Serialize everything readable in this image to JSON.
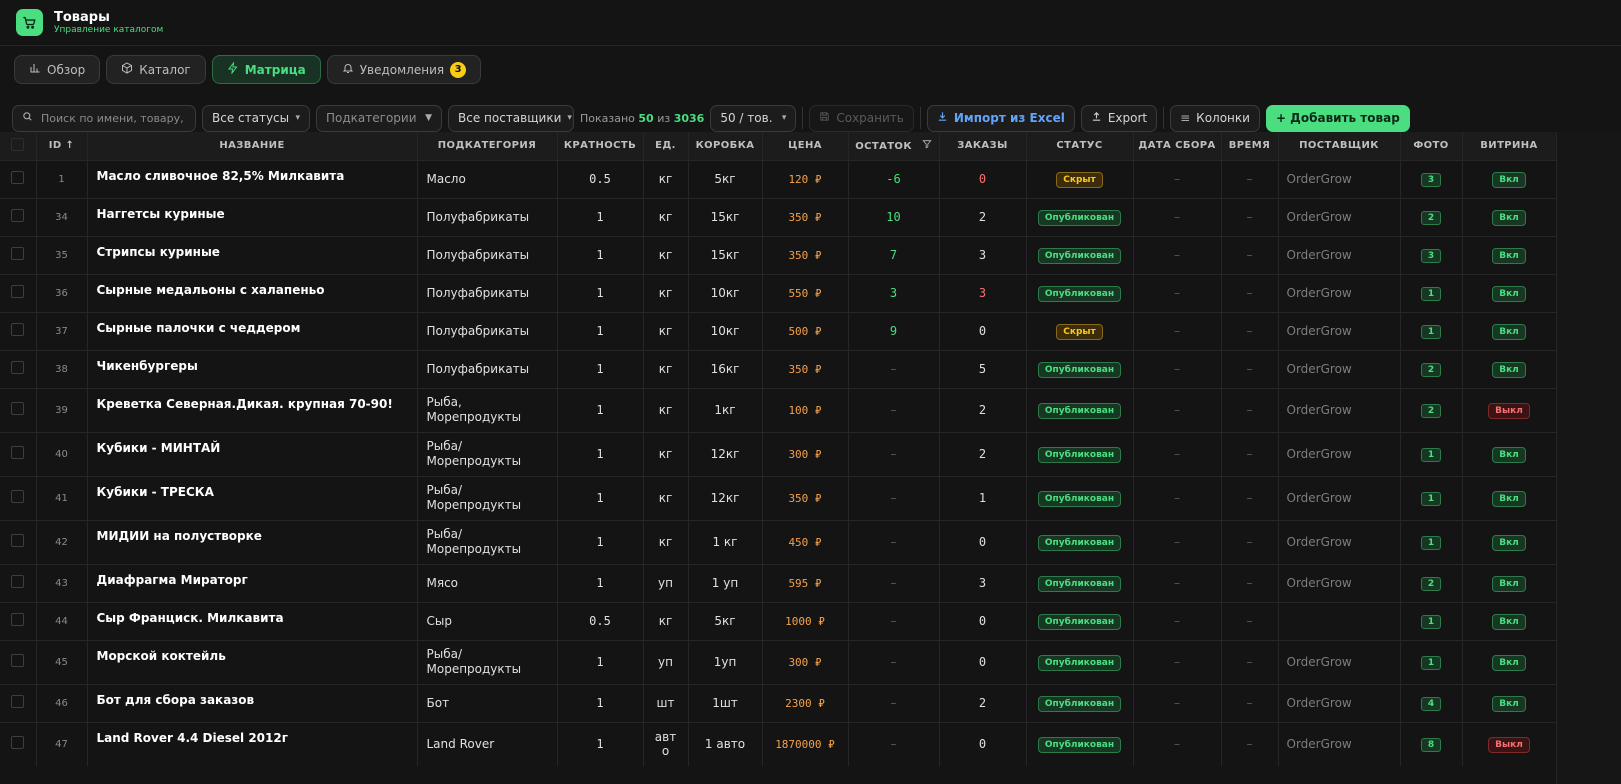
{
  "app": {
    "title": "Товары",
    "subtitle": "Управление каталогом"
  },
  "tabs": [
    {
      "label": "Обзор",
      "icon": "bar-chart-icon",
      "active": false
    },
    {
      "label": "Каталог",
      "icon": "box-icon",
      "active": false
    },
    {
      "label": "Матрица",
      "icon": "lightning-icon",
      "active": true
    },
    {
      "label": "Уведомления",
      "icon": "bell-icon",
      "active": false,
      "badge": "3"
    }
  ],
  "toolbar": {
    "search_placeholder": "Поиск по имени, товару, а",
    "status_filter": "Все статусы",
    "subcategory_filter": "Подкатегории",
    "supplier_filter": "Все поставщики",
    "shown_prefix": "Показано",
    "shown_count": "50",
    "shown_of": "из",
    "shown_total": "3036",
    "per_page": "50 / тов.",
    "save_label": "Сохранить",
    "import_label": "Импорт из Excel",
    "export_label": "Export",
    "columns_label": "Колонки",
    "add_label": "+ Добавить товар"
  },
  "columns": {
    "id": "ID ↑",
    "name": "НАЗВАНИЕ",
    "subcategory": "ПОДКАТЕГОРИЯ",
    "multiplicity": "КРАТНОСТЬ",
    "unit": "ЕД.",
    "box": "КОРОБКА",
    "price": "ЦЕНА",
    "stock": "ОСТАТОК",
    "orders": "ЗАКАЗЫ",
    "status": "СТАТУС",
    "date": "ДАТА СБОРА",
    "time": "ВРЕМЯ",
    "supplier": "ПОСТАВЩИК",
    "photo": "ФОТО",
    "showcase": "ВИТРИНА"
  },
  "rows": [
    {
      "id": "1",
      "name": "Масло сливочное 82,5% Милкавита",
      "sub": [
        "Масло"
      ],
      "mult": "0.5",
      "unit": [
        "кг"
      ],
      "box": "5кг",
      "price": "120 ₽",
      "stock": "-6",
      "stock_color": "green",
      "orders": "0",
      "orders_color": "red",
      "status": "Скрыт",
      "status_type": "hid",
      "date": "–",
      "time": "–",
      "supplier": "OrderGrow",
      "photo": "3",
      "showcase": "Вкл",
      "showcase_type": "on"
    },
    {
      "id": "34",
      "name": "Наггетсы куриные",
      "sub": [
        "Полуфабрикаты"
      ],
      "mult": "1",
      "unit": [
        "кг"
      ],
      "box": "15кг",
      "price": "350 ₽",
      "stock": "10",
      "stock_color": "green",
      "orders": "2",
      "orders_color": "",
      "status": "Опубликован",
      "status_type": "pub",
      "date": "–",
      "time": "–",
      "supplier": "OrderGrow",
      "photo": "2",
      "showcase": "Вкл",
      "showcase_type": "on"
    },
    {
      "id": "35",
      "name": "Стрипсы куриные",
      "sub": [
        "Полуфабрикаты"
      ],
      "mult": "1",
      "unit": [
        "кг"
      ],
      "box": "15кг",
      "price": "350 ₽",
      "stock": "7",
      "stock_color": "green",
      "orders": "3",
      "orders_color": "",
      "status": "Опубликован",
      "status_type": "pub",
      "date": "–",
      "time": "–",
      "supplier": "OrderGrow",
      "photo": "3",
      "showcase": "Вкл",
      "showcase_type": "on"
    },
    {
      "id": "36",
      "name": "Сырные медальоны с халапеньо",
      "sub": [
        "Полуфабрикаты"
      ],
      "mult": "1",
      "unit": [
        "кг"
      ],
      "box": "10кг",
      "price": "550 ₽",
      "stock": "3",
      "stock_color": "green",
      "orders": "3",
      "orders_color": "red",
      "status": "Опубликован",
      "status_type": "pub",
      "date": "–",
      "time": "–",
      "supplier": "OrderGrow",
      "photo": "1",
      "showcase": "Вкл",
      "showcase_type": "on"
    },
    {
      "id": "37",
      "name": "Сырные палочки с чеддером",
      "sub": [
        "Полуфабрикаты"
      ],
      "mult": "1",
      "unit": [
        "кг"
      ],
      "box": "10кг",
      "price": "500 ₽",
      "stock": "9",
      "stock_color": "green",
      "orders": "0",
      "orders_color": "",
      "status": "Скрыт",
      "status_type": "hid",
      "date": "–",
      "time": "–",
      "supplier": "OrderGrow",
      "photo": "1",
      "showcase": "Вкл",
      "showcase_type": "on"
    },
    {
      "id": "38",
      "name": "Чикенбургеры",
      "sub": [
        "Полуфабрикаты"
      ],
      "mult": "1",
      "unit": [
        "кг"
      ],
      "box": "16кг",
      "price": "350 ₽",
      "stock": "–",
      "stock_color": "green",
      "orders": "5",
      "orders_color": "",
      "status": "Опубликован",
      "status_type": "pub",
      "date": "–",
      "time": "–",
      "supplier": "OrderGrow",
      "photo": "2",
      "showcase": "Вкл",
      "showcase_type": "on"
    },
    {
      "id": "39",
      "name": "Креветка Северная.Дикая. крупная 70-90!",
      "sub": [
        "Рыба,",
        "Морепродукты"
      ],
      "mult": "1",
      "unit": [
        "кг"
      ],
      "box": "1кг",
      "price": "100 ₽",
      "stock": "–",
      "stock_color": "green",
      "orders": "2",
      "orders_color": "",
      "status": "Опубликован",
      "status_type": "pub",
      "date": "–",
      "time": "–",
      "supplier": "OrderGrow",
      "photo": "2",
      "showcase": "Выкл",
      "showcase_type": "off"
    },
    {
      "id": "40",
      "name": "Кубики - МИНТАЙ",
      "sub": [
        "Рыба/",
        "Морепродукты"
      ],
      "mult": "1",
      "unit": [
        "кг"
      ],
      "box": "12кг",
      "price": "300 ₽",
      "stock": "–",
      "stock_color": "green",
      "orders": "2",
      "orders_color": "",
      "status": "Опубликован",
      "status_type": "pub",
      "date": "–",
      "time": "–",
      "supplier": "OrderGrow",
      "photo": "1",
      "showcase": "Вкл",
      "showcase_type": "on"
    },
    {
      "id": "41",
      "name": "Кубики - ТРЕСКА",
      "sub": [
        "Рыба/",
        "Морепродукты"
      ],
      "mult": "1",
      "unit": [
        "кг"
      ],
      "box": "12кг",
      "price": "350 ₽",
      "stock": "–",
      "stock_color": "green",
      "orders": "1",
      "orders_color": "",
      "status": "Опубликован",
      "status_type": "pub",
      "date": "–",
      "time": "–",
      "supplier": "OrderGrow",
      "photo": "1",
      "showcase": "Вкл",
      "showcase_type": "on"
    },
    {
      "id": "42",
      "name": "МИДИИ на полустворке",
      "sub": [
        "Рыба/",
        "Морепродукты"
      ],
      "mult": "1",
      "unit": [
        "кг"
      ],
      "box": "1 кг",
      "price": "450 ₽",
      "stock": "–",
      "stock_color": "green",
      "orders": "0",
      "orders_color": "",
      "status": "Опубликован",
      "status_type": "pub",
      "date": "–",
      "time": "–",
      "supplier": "OrderGrow",
      "photo": "1",
      "showcase": "Вкл",
      "showcase_type": "on"
    },
    {
      "id": "43",
      "name": "Диафрагма Мираторг",
      "sub": [
        "Мясо"
      ],
      "mult": "1",
      "unit": [
        "уп"
      ],
      "box": "1 уп",
      "price": "595 ₽",
      "stock": "–",
      "stock_color": "green",
      "orders": "3",
      "orders_color": "",
      "status": "Опубликован",
      "status_type": "pub",
      "date": "–",
      "time": "–",
      "supplier": "OrderGrow",
      "photo": "2",
      "showcase": "Вкл",
      "showcase_type": "on"
    },
    {
      "id": "44",
      "name": "Сыр Франциск. Милкавита",
      "sub": [
        "Сыр"
      ],
      "mult": "0.5",
      "unit": [
        "кг"
      ],
      "box": "5кг",
      "price": "1000 ₽",
      "stock": "–",
      "stock_color": "green",
      "orders": "0",
      "orders_color": "",
      "status": "Опубликован",
      "status_type": "pub",
      "date": "–",
      "time": "–",
      "supplier": "",
      "photo": "1",
      "showcase": "Вкл",
      "showcase_type": "on"
    },
    {
      "id": "45",
      "name": "Морской коктейль",
      "sub": [
        "Рыба/",
        "Морепродукты"
      ],
      "mult": "1",
      "unit": [
        "уп"
      ],
      "box": "1уп",
      "price": "300 ₽",
      "stock": "–",
      "stock_color": "green",
      "orders": "0",
      "orders_color": "",
      "status": "Опубликован",
      "status_type": "pub",
      "date": "–",
      "time": "–",
      "supplier": "OrderGrow",
      "photo": "1",
      "showcase": "Вкл",
      "showcase_type": "on"
    },
    {
      "id": "46",
      "name": "Бот для сбора заказов",
      "sub": [
        "Бот"
      ],
      "mult": "1",
      "unit": [
        "шт"
      ],
      "box": "1шт",
      "price": "2300 ₽",
      "stock": "–",
      "stock_color": "green",
      "orders": "2",
      "orders_color": "",
      "status": "Опубликован",
      "status_type": "pub",
      "date": "–",
      "time": "–",
      "supplier": "OrderGrow",
      "photo": "4",
      "showcase": "Вкл",
      "showcase_type": "on"
    },
    {
      "id": "47",
      "name": "Land Rover 4.4 Diesel 2012г",
      "sub": [
        "Land Rover"
      ],
      "mult": "1",
      "unit": [
        "авт",
        "о"
      ],
      "box": "1 авто",
      "price": "1870000 ₽",
      "stock": "–",
      "stock_color": "green",
      "orders": "0",
      "orders_color": "",
      "status": "Опубликован",
      "status_type": "pub",
      "date": "–",
      "time": "–",
      "supplier": "OrderGrow",
      "photo": "8",
      "showcase": "Выкл",
      "showcase_type": "off"
    }
  ]
}
